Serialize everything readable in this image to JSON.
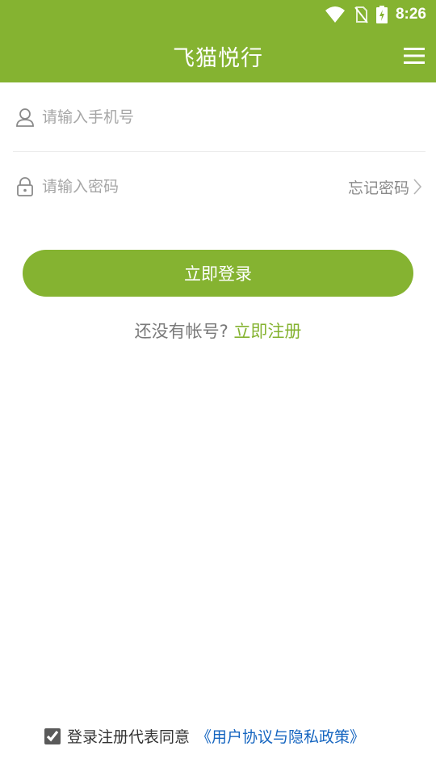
{
  "status_bar": {
    "time": "8:26"
  },
  "header": {
    "title": "飞猫悦行"
  },
  "form": {
    "phone_placeholder": "请输入手机号",
    "password_placeholder": "请输入密码",
    "forgot_label": "忘记密码"
  },
  "login_button_label": "立即登录",
  "register": {
    "prompt": "还没有帐号?",
    "link_label": "立即注册"
  },
  "agreement": {
    "text": "登录注册代表同意",
    "link_label": "《用户协议与隐私政策》",
    "checked": true
  },
  "colors": {
    "brand": "#85b331",
    "link": "#1565c0"
  }
}
